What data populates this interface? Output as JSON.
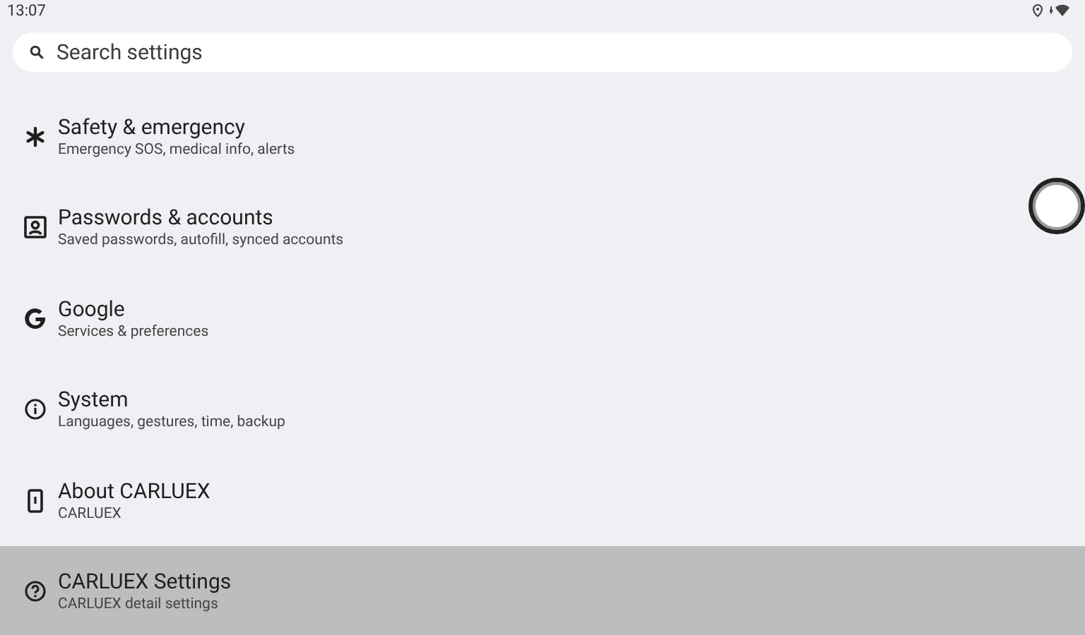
{
  "status_bar": {
    "time": "13:07"
  },
  "search": {
    "placeholder": "Search settings"
  },
  "items": [
    {
      "kind": "safety",
      "title": "Safety & emergency",
      "summary": "Emergency SOS, medical info, alerts",
      "selected": false
    },
    {
      "kind": "accounts",
      "title": "Passwords & accounts",
      "summary": "Saved passwords, autofill, synced accounts",
      "selected": false
    },
    {
      "kind": "google",
      "title": "Google",
      "summary": "Services & preferences",
      "selected": false
    },
    {
      "kind": "system",
      "title": "System",
      "summary": "Languages, gestures, time, backup",
      "selected": false
    },
    {
      "kind": "about",
      "title": "About CARLUEX",
      "summary": "CARLUEX",
      "selected": false
    },
    {
      "kind": "help",
      "title": "CARLUEX Settings",
      "summary": "CARLUEX detail settings",
      "selected": true
    }
  ]
}
